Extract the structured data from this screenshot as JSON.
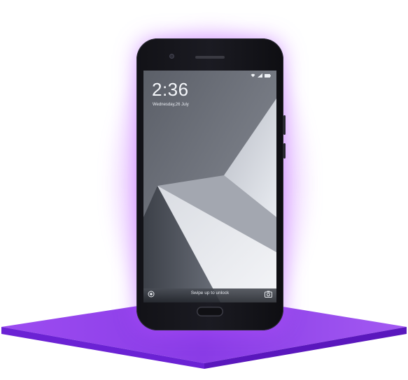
{
  "lockscreen": {
    "time": "2:36",
    "date": "Wednesday,26 July",
    "swipe_hint": "Swipe up to unlock"
  },
  "icons": {
    "wifi": "wifi-icon",
    "signal": "signal-icon",
    "battery": "battery-icon",
    "circle_shortcut": "circle-icon",
    "camera_shortcut": "camera-icon"
  },
  "colors": {
    "platform_top": "#8b3fe8",
    "platform_side": "#6a1fd1",
    "glow": "#be5aff",
    "phone_body": "#16161c"
  }
}
